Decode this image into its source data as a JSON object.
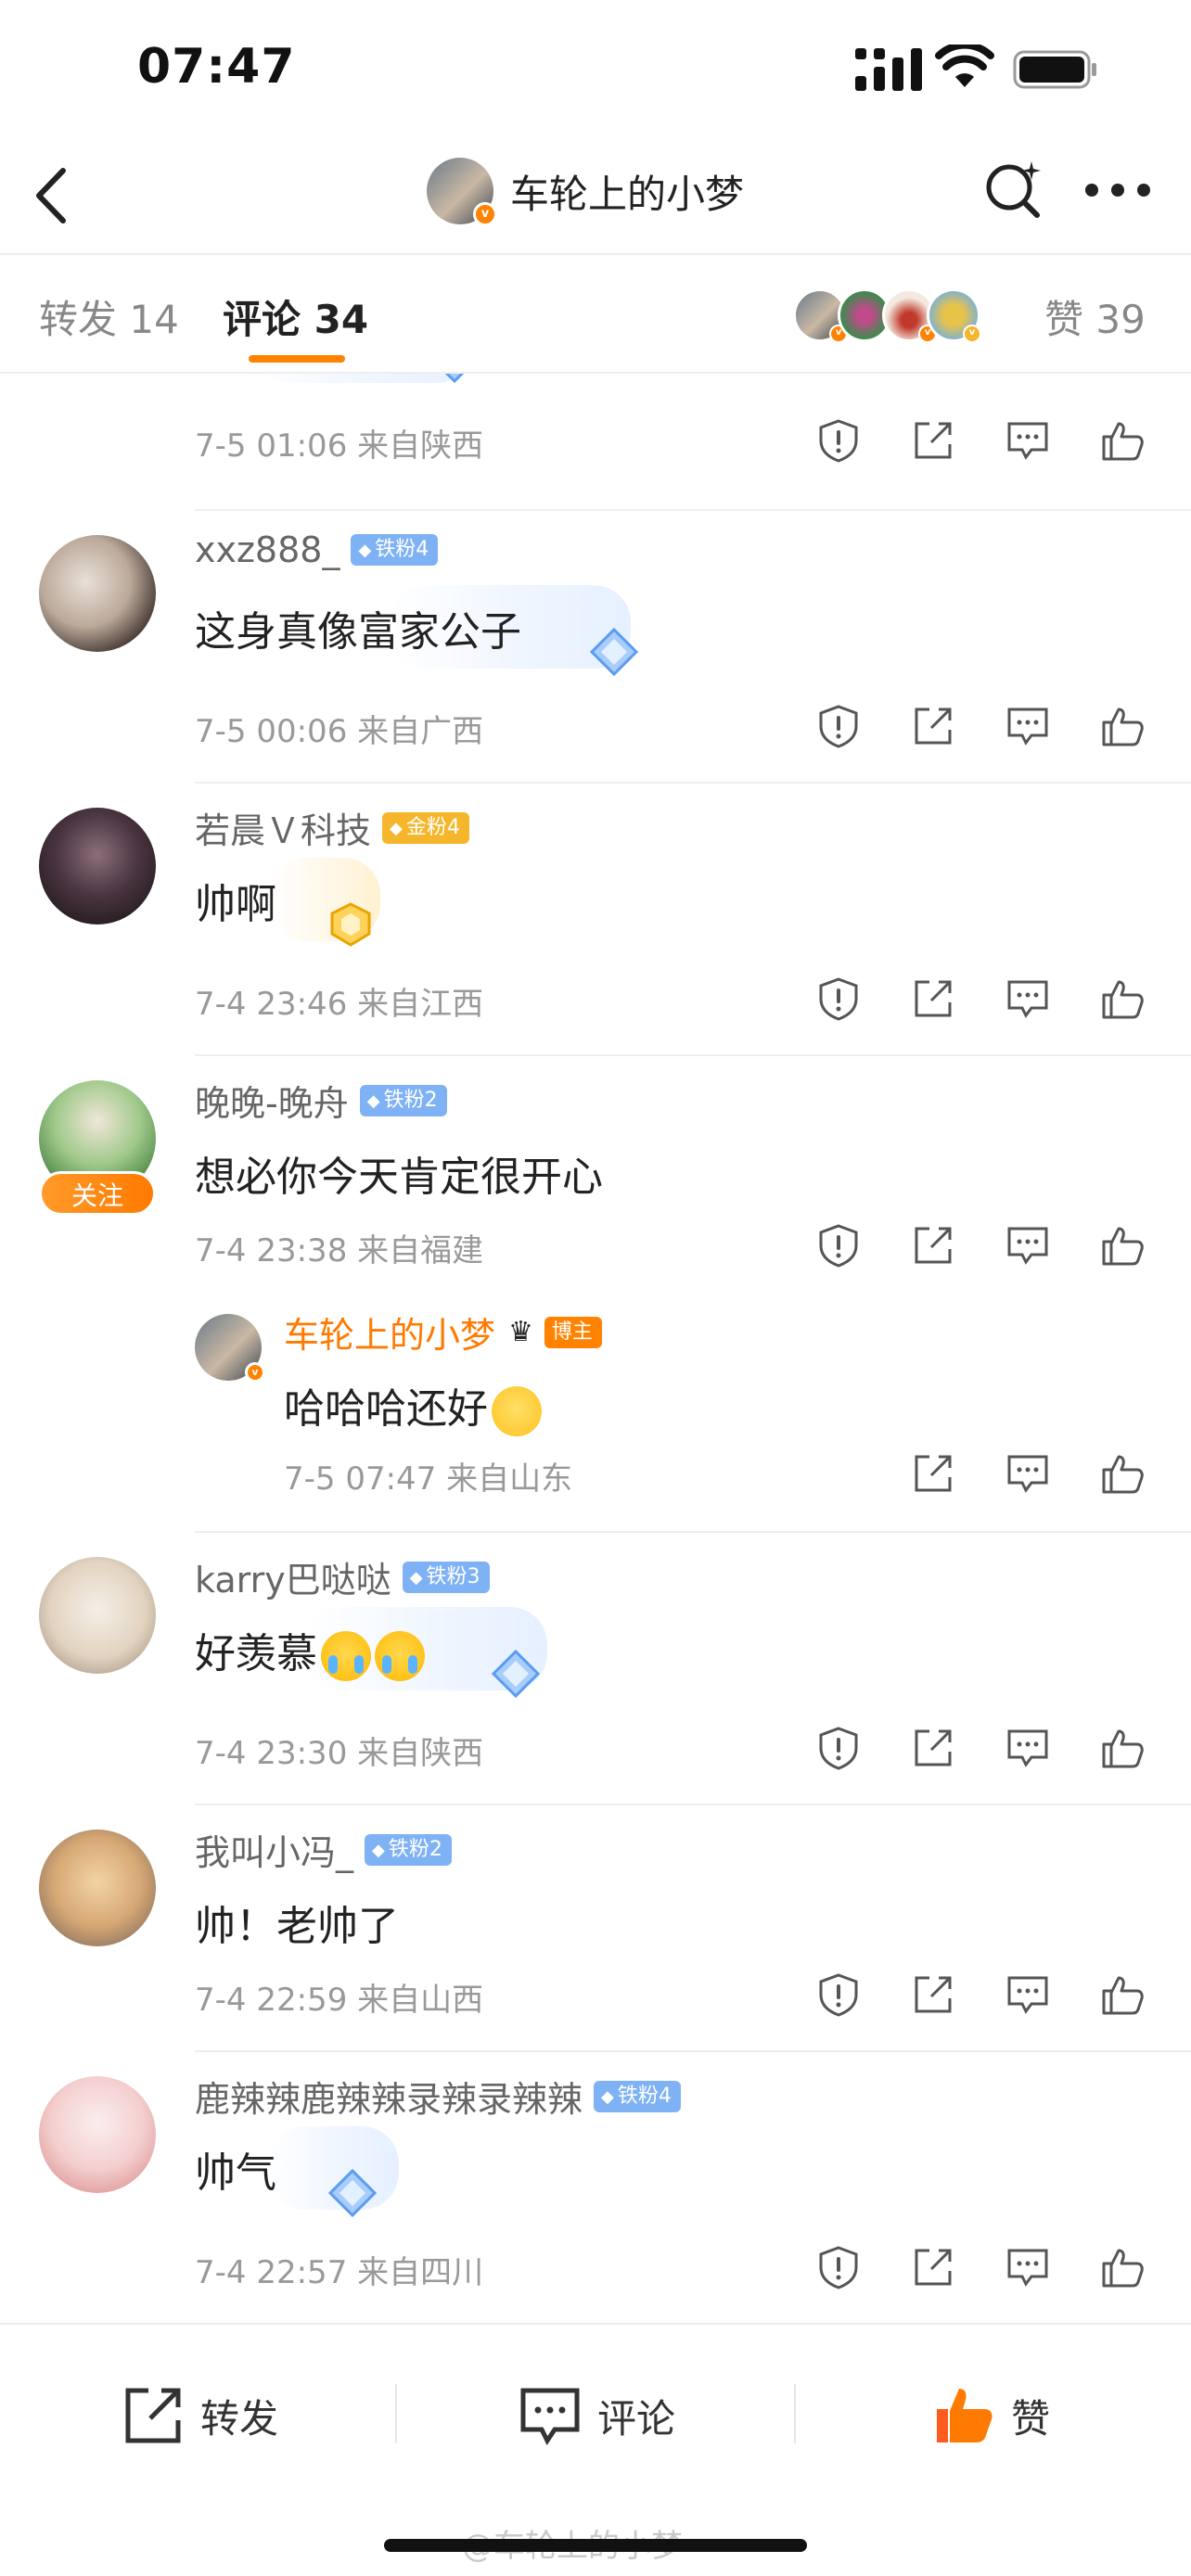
{
  "status_bar": {
    "time": "07:47"
  },
  "nav": {
    "title": "车轮上的小梦"
  },
  "tabs": {
    "repost": "转发 14",
    "comment": "评论 34",
    "likes": "赞 39"
  },
  "comments": [
    {
      "name": "",
      "text": "",
      "meta": "7-5 01:06  来自陕西"
    },
    {
      "name": "xxz888_",
      "badge": "铁粉4",
      "text": "这身真像富家公子",
      "meta": "7-5 00:06  来自广西"
    },
    {
      "name": "若晨Ｖ科技",
      "badge": "金粉4",
      "text": "帅啊",
      "meta": "7-4 23:46  来自江西"
    },
    {
      "name": "晚晚-晚舟",
      "badge": "铁粉2",
      "text": "想必你今天肯定很开心",
      "meta": "7-4 23:38  来自福建",
      "follow": "关注"
    },
    {
      "name": "karry巴哒哒",
      "badge": "铁粉3",
      "text": "好羡慕",
      "meta": "7-4 23:30  来自陕西"
    },
    {
      "name": "我叫小冯_",
      "badge": "铁粉2",
      "text": "帅！老帅了",
      "meta": "7-4 22:59  来自山西"
    },
    {
      "name": "鹿辣辣鹿辣辣录辣录辣辣",
      "badge": "铁粉4",
      "text": "帅气",
      "meta": "7-4 22:57  来自四川"
    }
  ],
  "reply": {
    "name": "车轮上的小梦",
    "badge": "博主",
    "text": "哈哈哈还好",
    "meta": "7-5 07:47  来自山东"
  },
  "bottom_bar": {
    "repost": "转发",
    "comment": "评论",
    "like": "赞"
  },
  "watermark": "@车轮上的小梦",
  "colors": {
    "accent": "#ff8200",
    "iron_badge": "#7fb2f5",
    "gold_badge": "#f6b62b"
  },
  "icons": [
    "back-icon",
    "search-icon",
    "more-icon",
    "report-icon",
    "share-icon",
    "comment-icon",
    "like-icon"
  ]
}
